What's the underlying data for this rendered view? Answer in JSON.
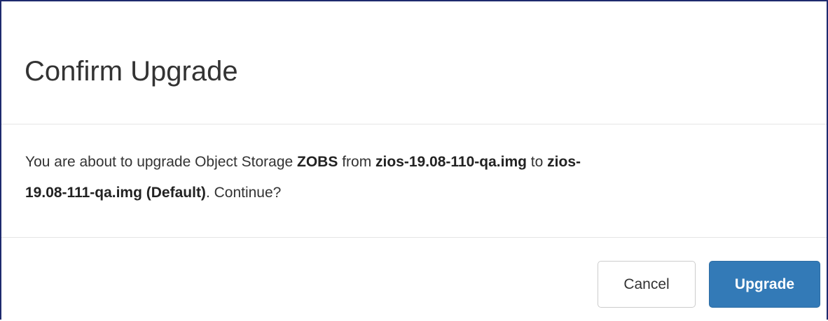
{
  "dialog": {
    "title": "Confirm Upgrade",
    "message": {
      "prefix": "You are about to upgrade Object Storage ",
      "storage_name": "ZOBS",
      "from_text": " from ",
      "from_image": "zios-19.08-110-qa.img",
      "to_text": " to ",
      "to_image_part1": "zios-",
      "to_image_part2": "19.08-111-qa.img (Default)",
      "suffix": ". Continue?"
    },
    "buttons": {
      "cancel_label": "Cancel",
      "upgrade_label": "Upgrade"
    }
  },
  "colors": {
    "primary": "#337ab7",
    "border": "#1e2a6e",
    "text": "#333333"
  }
}
